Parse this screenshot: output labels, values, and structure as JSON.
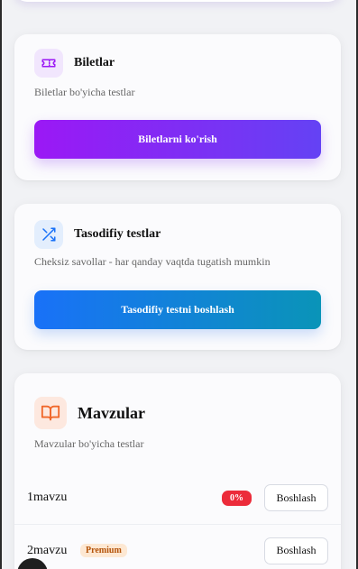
{
  "biletlar": {
    "icon": "ticket-icon",
    "title": "Biletlar",
    "description": "Biletlar bo'yicha testlar",
    "button_label": "Biletlarni ko'rish",
    "accent": "#8b2ff5"
  },
  "random_tests": {
    "icon": "shuffle-icon",
    "title": "Tasodifiy testlar",
    "description": "Cheksiz savollar - har qanday vaqtda tugatish mumkin",
    "button_label": "Tasodifiy testni boshlash",
    "accent": "#1971f8"
  },
  "mavzular": {
    "icon": "book-icon",
    "title": "Mavzular",
    "description": "Mavzular bo'yicha testlar",
    "accent": "#f0672a",
    "topics": [
      {
        "name": "1mavzu",
        "progress": "0%",
        "action": "Boshlash"
      },
      {
        "name": "2mavzu",
        "premium": "Premium",
        "action": "Boshlash"
      }
    ]
  }
}
